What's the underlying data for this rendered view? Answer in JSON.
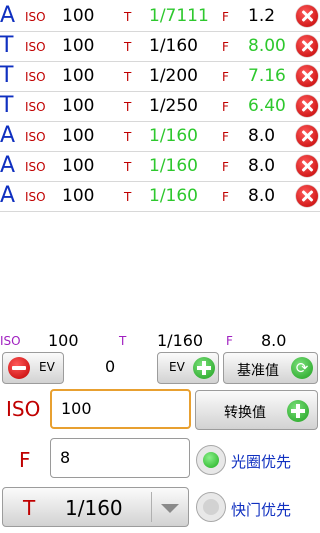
{
  "list": {
    "rows": [
      {
        "mode": "A",
        "iso_label": "ISO",
        "iso": "100",
        "t_label": "T",
        "t": "1/7111",
        "f_label": "F",
        "f": "1.2"
      },
      {
        "mode": "T",
        "iso_label": "ISO",
        "iso": "100",
        "t_label": "T",
        "t": "1/160",
        "f_label": "F",
        "f": "8.00"
      },
      {
        "mode": "T",
        "iso_label": "ISO",
        "iso": "100",
        "t_label": "T",
        "t": "1/200",
        "f_label": "F",
        "f": "7.16"
      },
      {
        "mode": "T",
        "iso_label": "ISO",
        "iso": "100",
        "t_label": "T",
        "t": "1/250",
        "f_label": "F",
        "f": "6.40"
      },
      {
        "mode": "A",
        "iso_label": "ISO",
        "iso": "100",
        "t_label": "T",
        "t": "1/160",
        "f_label": "F",
        "f": "8.0"
      },
      {
        "mode": "A",
        "iso_label": "ISO",
        "iso": "100",
        "t_label": "T",
        "t": "1/160",
        "f_label": "F",
        "f": "8.0"
      },
      {
        "mode": "A",
        "iso_label": "ISO",
        "iso": "100",
        "t_label": "T",
        "t": "1/160",
        "f_label": "F",
        "f": "8.0"
      }
    ]
  },
  "summary": {
    "iso_label": "ISO",
    "iso": "100",
    "t_label": "T",
    "t": "1/160",
    "f_label": "F",
    "f": "8.0"
  },
  "controls": {
    "ev_minus_label": "EV",
    "ev_value": "0",
    "ev_plus_label": "EV",
    "baseline_label": "基准值",
    "iso_label": "ISO",
    "iso_value": "100",
    "convert_label": "转换值",
    "f_label": "F",
    "f_value": "8",
    "aperture_priority_label": "光圈优先",
    "t_label": "T",
    "t_value": "1/160",
    "shutter_priority_label": "快门优先"
  },
  "colors": {
    "accent_red": "#c00000",
    "mode_blue": "#1030c0",
    "highlight_green": "#2ec82e",
    "summary_purple": "#a020c0",
    "focus_orange": "#e8a030"
  }
}
